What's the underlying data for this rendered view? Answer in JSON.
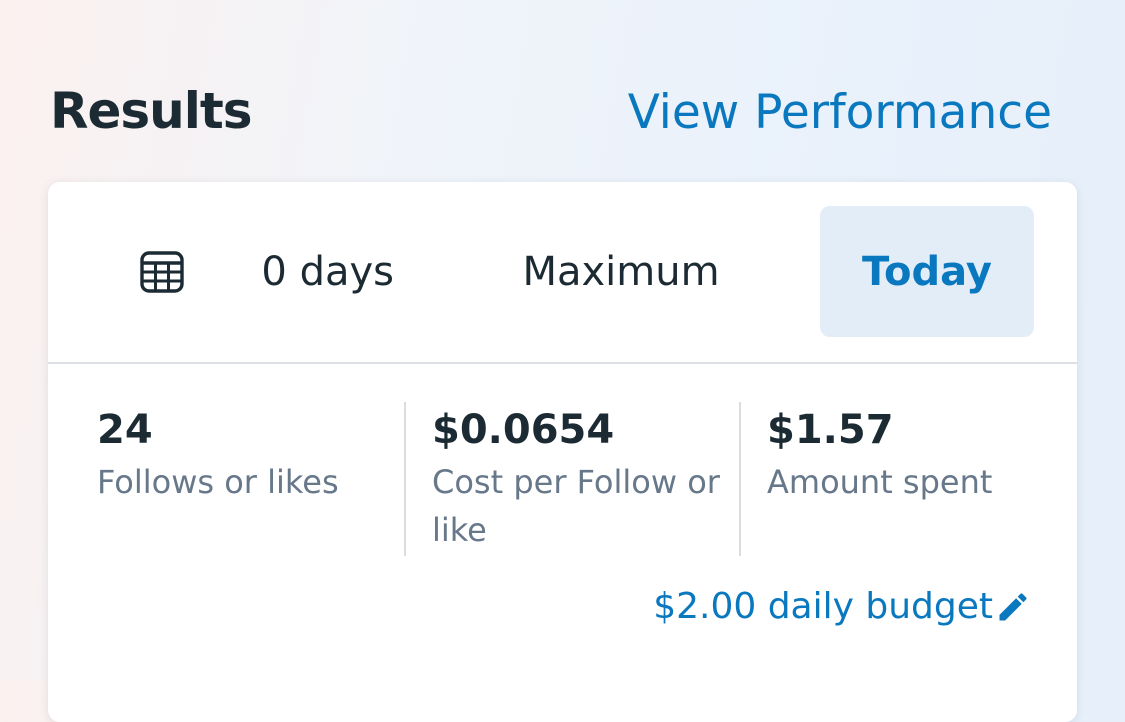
{
  "header": {
    "title": "Results",
    "view_performance_link": "View Performance"
  },
  "date_tabs": {
    "icon": "calendar-table-icon",
    "items": [
      {
        "label": "0 days",
        "selected": false
      },
      {
        "label": "Maximum",
        "selected": false
      },
      {
        "label": "Today",
        "selected": true
      }
    ]
  },
  "metrics": [
    {
      "value": "24",
      "label": "Follows or likes"
    },
    {
      "value": "$0.0654",
      "label": "Cost per Follow or like"
    },
    {
      "value": "$1.57",
      "label": "Amount spent"
    }
  ],
  "budget": {
    "label": "$2.00 daily budget",
    "icon": "pencil-edit-icon"
  },
  "colors": {
    "accent": "#0a78be",
    "text_primary": "#1c2b33",
    "text_secondary": "#67788a",
    "selected_tab_bg": "#e3edf8"
  }
}
